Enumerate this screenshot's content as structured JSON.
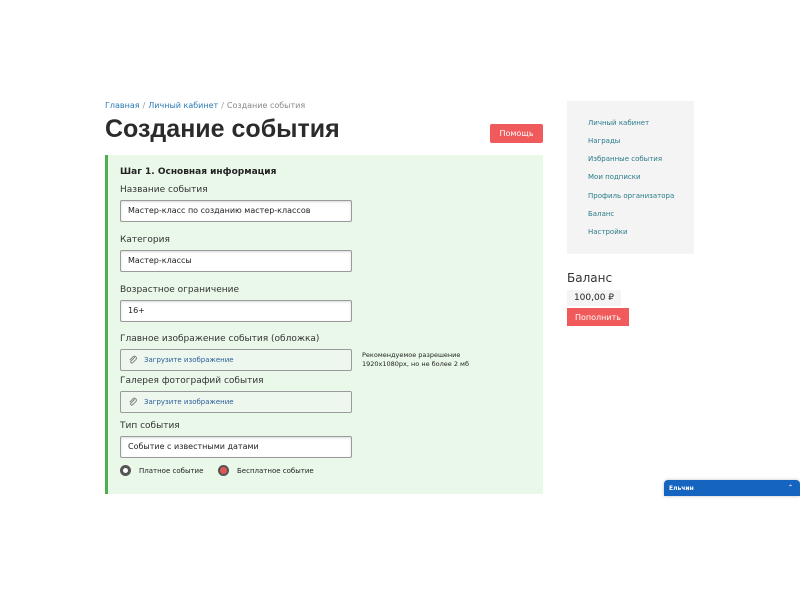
{
  "breadcrumb": {
    "home": "Главная",
    "sep1": "/",
    "account": "Личный кабинет",
    "sep2": "/",
    "current": "Создание события"
  },
  "page_title": "Создание события",
  "help_label": "Помощь",
  "form": {
    "step_title": "Шаг 1. Основная информация",
    "event_name": {
      "label": "Название события",
      "value": "Мастер-класс по созданию мастер-классов"
    },
    "category": {
      "label": "Категория",
      "value": "Мастер-классы"
    },
    "age": {
      "label": "Возрастное ограничение",
      "value": "16+"
    },
    "cover": {
      "label": "Главное изображение события (обложка)",
      "upload_label": "Загрузите изображение",
      "note_line1": "Рекомендуемое разрешение",
      "note_line2": "1920x1080px, но не более 2 мб"
    },
    "gallery": {
      "label": "Галерея фотографий события",
      "upload_label": "Загрузите изображение"
    },
    "event_type": {
      "label": "Тип события",
      "value": "Событие с известными датами"
    },
    "payment": {
      "options": [
        {
          "label": "Платное событие",
          "selected": false
        },
        {
          "label": "Бесплатное событие",
          "selected": true
        }
      ]
    }
  },
  "sidebar": {
    "items": [
      {
        "label": "Личный кабинет"
      },
      {
        "label": "Награды"
      },
      {
        "label": "Избранные события"
      },
      {
        "label": "Мои подписки"
      },
      {
        "label": "Профиль организатора"
      },
      {
        "label": "Баланс"
      },
      {
        "label": "Настройки"
      }
    ]
  },
  "balance": {
    "title": "Баланс",
    "value": "100,00 ₽",
    "topup_label": "Пополнить"
  },
  "chat": {
    "name": "Ельчин",
    "caret": "⌃"
  },
  "icons": {
    "upload": "paperclip-icon"
  },
  "colors": {
    "accent_red": "#f05a5a",
    "panel_green": "#e9f8e9",
    "border_green": "#4caf50",
    "chat_blue": "#1565c0"
  }
}
